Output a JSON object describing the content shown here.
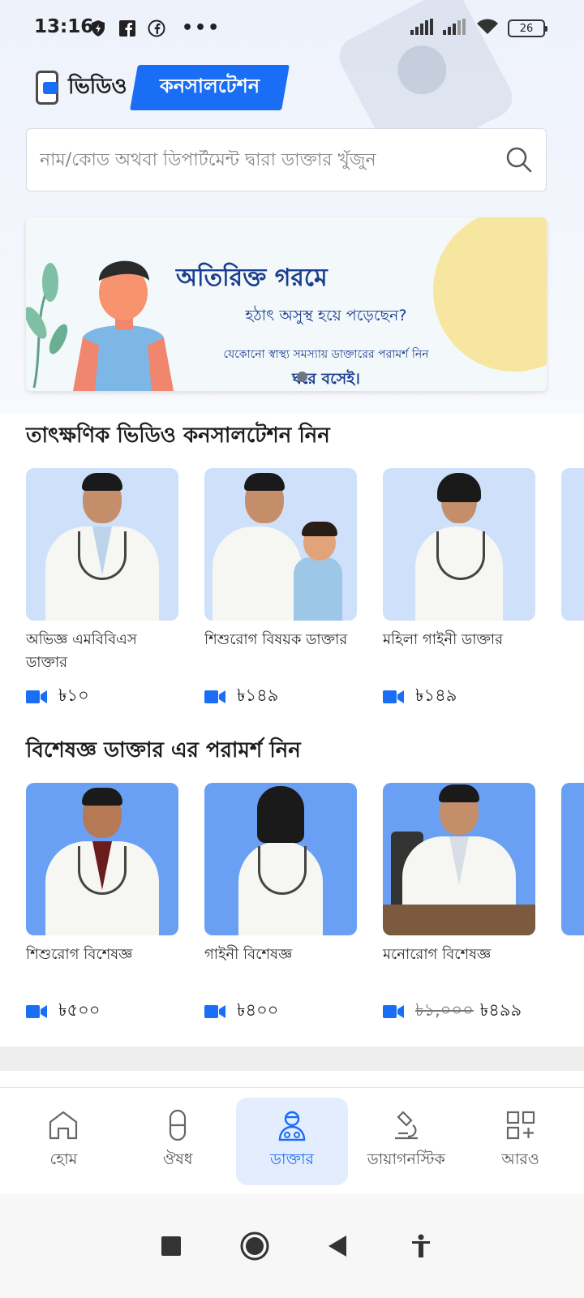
{
  "status_bar": {
    "time": "13:16",
    "battery": "26"
  },
  "header": {
    "logo_word_1": "ভিডিও",
    "logo_word_2": "কনসালটেশন"
  },
  "search": {
    "placeholder": "নাম/কোড অথবা ডিপার্টমেন্ট দ্বারা ডাক্তার খুঁজুন"
  },
  "banner": {
    "title": "অতিরিক্ত গরমে",
    "subtitle": "হঠাৎ অসুস্থ হয়ে পড়েছেন?",
    "line": "যেকোনো স্বাস্থ্য সমস্যায় ডাক্তারের পরামর্শ নিন",
    "line2": "ঘরে বসেই।"
  },
  "instant_section": {
    "title": "তাৎক্ষণিক ভিডিও কনসালটেশন নিন",
    "cards": [
      {
        "label": "অভিজ্ঞ এমবিবিএস ডাক্তার",
        "price": "৳১০"
      },
      {
        "label": "শিশুরোগ বিষয়ক ডাক্তার",
        "price": "৳১৪৯"
      },
      {
        "label": "মহিলা গাইনী ডাক্তার",
        "price": "৳১৪৯"
      }
    ]
  },
  "specialist_section": {
    "title": "বিশেষজ্ঞ ডাক্তার এর পরামর্শ নিন",
    "cards": [
      {
        "label": "শিশুরোগ বিশেষজ্ঞ",
        "price": "৳৫০০"
      },
      {
        "label": "গাইনী বিশেষজ্ঞ",
        "price": "৳৪০০"
      },
      {
        "label": "মনোরোগ বিশেষজ্ঞ",
        "old_price": "৳১,০০০",
        "price": "৳৪৯৯"
      }
    ]
  },
  "bottom_nav": {
    "items": [
      {
        "label": "হোম",
        "icon": "home-icon"
      },
      {
        "label": "ঔষধ",
        "icon": "pill-icon"
      },
      {
        "label": "ডাক্তার",
        "icon": "doctor-icon",
        "active": true
      },
      {
        "label": "ডায়াগনস্টিক",
        "icon": "microscope-icon"
      },
      {
        "label": "আরও",
        "icon": "more-grid-icon"
      }
    ]
  },
  "colors": {
    "accent": "#1a6ef5",
    "card_light": "#cfe0fb",
    "card_dark": "#6aa0f4"
  }
}
